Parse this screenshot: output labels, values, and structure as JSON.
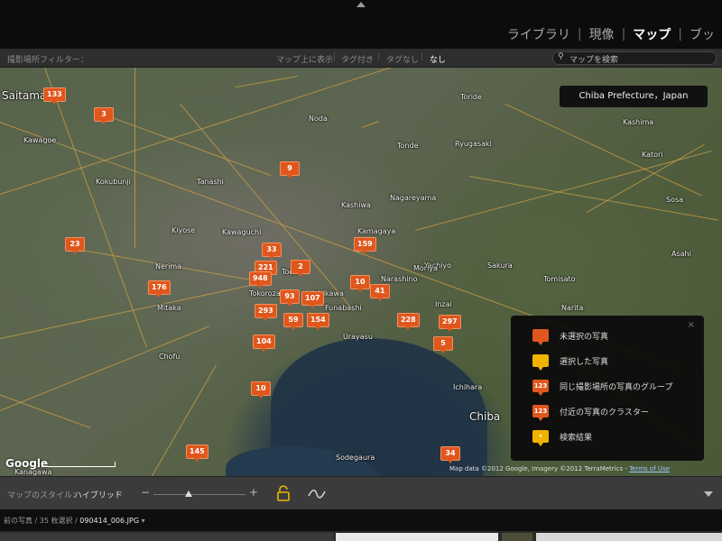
{
  "modules": {
    "items": [
      "ライブラリ",
      "現像",
      "マップ",
      "ブッ"
    ],
    "active": "マップ",
    "separator": "|"
  },
  "filter_bar": {
    "label": "撮影場所フィルター：",
    "options": [
      "マップ上に表示",
      "タグ付き",
      "タグなし",
      "なし"
    ],
    "active": "なし",
    "separator": "|",
    "search_placeholder": "マップを検索"
  },
  "map": {
    "tooltip": "Chiba Prefecture，Japan",
    "google_logo": "Google",
    "copyright_text": "Map data ©2012 Google, Imagery ©2012 TerraMetrics -",
    "terms_link": "Terms of Use",
    "places": [
      {
        "name": "Saitama"
      },
      {
        "name": "Kawaguchi"
      },
      {
        "name": "Kawagoe"
      },
      {
        "name": "Kashiwa"
      },
      {
        "name": "Noda"
      },
      {
        "name": "Tonde"
      },
      {
        "name": "Ryugasaki"
      },
      {
        "name": "Kamagaya"
      },
      {
        "name": "Yachiyo"
      },
      {
        "name": "Narashino"
      },
      {
        "name": "Sakura"
      },
      {
        "name": "Tomisato"
      },
      {
        "name": "Chiba"
      },
      {
        "name": "Sodegaura"
      },
      {
        "name": "Kanagawa"
      },
      {
        "name": "Kokubunji"
      },
      {
        "name": "Nerima"
      },
      {
        "name": "Tokorozawa"
      },
      {
        "name": "Nagareyama"
      },
      {
        "name": "Katori"
      },
      {
        "name": "Sosa"
      },
      {
        "name": "Tanashi"
      },
      {
        "name": "Toda"
      },
      {
        "name": "Kiyose"
      },
      {
        "name": "Moriya"
      },
      {
        "name": "Asahi"
      },
      {
        "name": "Ichihara"
      },
      {
        "name": "Ichikawa"
      },
      {
        "name": "Funabashi"
      },
      {
        "name": "Urayasu"
      },
      {
        "name": "Mitaka"
      },
      {
        "name": "Chofu"
      },
      {
        "name": "Inzai"
      },
      {
        "name": "Narita"
      },
      {
        "name": "Toride"
      },
      {
        "name": "Kashima"
      }
    ],
    "markers": [
      "133",
      "3",
      "9",
      "23",
      "33",
      "159",
      "221",
      "2",
      "948",
      "176",
      "10",
      "41",
      "93",
      "107",
      "293",
      "59",
      "154",
      "228",
      "297",
      "104",
      "5",
      "10",
      "145",
      "34"
    ]
  },
  "legend": {
    "close": "×",
    "items": [
      {
        "label": "未選択の写真",
        "color": "#e0571d",
        "icon_text": ""
      },
      {
        "label": "選択した写真",
        "color": "#f0b400",
        "icon_text": ""
      },
      {
        "label": "同じ撮影場所の写真のグループ",
        "color": "#e0571d",
        "icon_text": "123"
      },
      {
        "label": "付近の写真のクラスター",
        "color": "#e0571d",
        "icon_text": "123"
      },
      {
        "label": "検索結果",
        "color": "#f0b400",
        "icon_text": "•"
      }
    ]
  },
  "style_bar": {
    "label": "マップのスタイル：",
    "value": "ハイブリッド",
    "caret": "÷",
    "zoom_minus": "−",
    "zoom_plus": "+",
    "zoom_level": 0.38
  },
  "footer": {
    "prefix": "前の写真 / 35 枚選択 /",
    "filename": "090414_006.JPG",
    "caret": "▾"
  },
  "colors": {
    "marker": "#e0571d",
    "selected": "#f0b400",
    "active_text": "#ffffff"
  }
}
